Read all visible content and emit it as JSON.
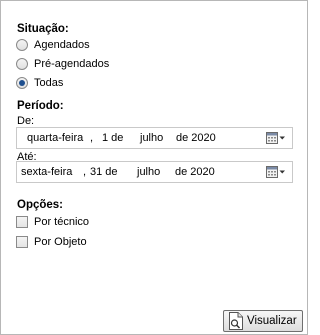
{
  "situacao": {
    "title": "Situação:",
    "options": [
      {
        "label": "Agendados",
        "checked": false
      },
      {
        "label": "Pré-agendados",
        "checked": false
      },
      {
        "label": "Todas",
        "checked": true
      }
    ]
  },
  "periodo": {
    "title": "Período:",
    "de": {
      "label": "De:",
      "weekday": "quarta-feira",
      "sep": ",",
      "day": "1 de",
      "month": "julho",
      "year": "de 2020"
    },
    "ate": {
      "label": "Até:",
      "weekday": "sexta-feira",
      "sep": ",",
      "day": "31 de",
      "month": "julho",
      "year": "de 2020"
    }
  },
  "opcoes": {
    "title": "Opções:",
    "items": [
      {
        "label": "Por técnico",
        "checked": false
      },
      {
        "label": "Por Objeto",
        "checked": false
      }
    ]
  },
  "button": {
    "label": "Visualizar"
  }
}
